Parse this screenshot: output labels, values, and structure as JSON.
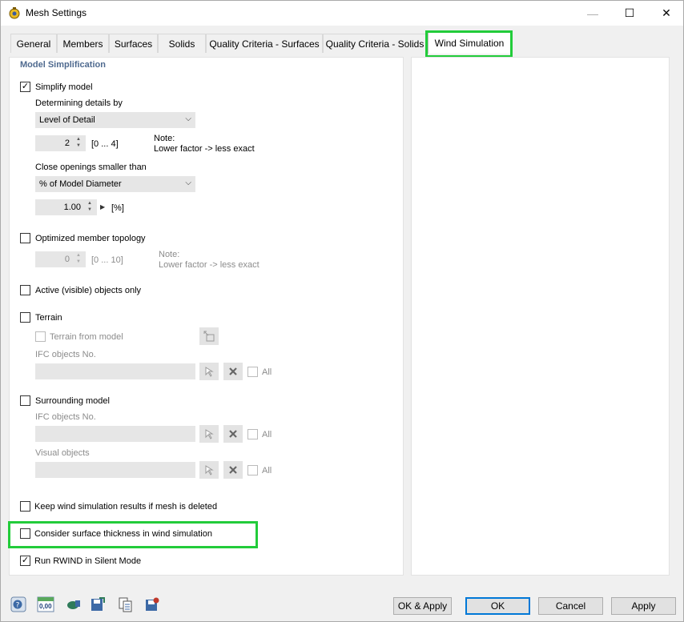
{
  "window": {
    "title": "Mesh Settings",
    "controls": {
      "minimize": "—",
      "maximize": "☐",
      "close": "✕"
    }
  },
  "tabs": [
    {
      "label": "General"
    },
    {
      "label": "Members"
    },
    {
      "label": "Surfaces"
    },
    {
      "label": "Solids"
    },
    {
      "label": "Quality Criteria - Surfaces"
    },
    {
      "label": "Quality Criteria - Solids"
    },
    {
      "label": "Wind Simulation",
      "active": true
    }
  ],
  "model_simplification": {
    "heading": "Model Simplification",
    "simplify_model": {
      "label": "Simplify model",
      "checked": true
    },
    "determining_label": "Determining details by",
    "determining_value": "Level of Detail",
    "level_value": "2",
    "level_range": "[0 ... 4]",
    "note_title": "Note:",
    "note_text": "Lower factor -> less exact",
    "close_openings_label": "Close openings smaller than",
    "close_openings_value": "% of Model Diameter",
    "diameter_value": "1.00",
    "diameter_unit": "[%]"
  },
  "optimized_topology": {
    "label": "Optimized member topology",
    "checked": false,
    "value": "0",
    "range": "[0 ... 10]",
    "note_title": "Note:",
    "note_text": "Lower factor -> less exact"
  },
  "active_objects": {
    "label": "Active (visible) objects only",
    "checked": false
  },
  "terrain": {
    "label": "Terrain",
    "checked": false,
    "from_model_label": "Terrain from model",
    "ifc_label": "IFC objects No.",
    "all_label": "All"
  },
  "surrounding": {
    "label": "Surrounding model",
    "checked": false,
    "ifc_label": "IFC objects No.",
    "visual_label": "Visual objects",
    "all_label": "All"
  },
  "keep_results": {
    "label": "Keep wind simulation results if mesh is deleted",
    "checked": false
  },
  "consider_thickness": {
    "label": "Consider surface thickness in wind simulation",
    "checked": false
  },
  "silent_mode": {
    "label": "Run RWIND in Silent Mode",
    "checked": true
  },
  "footer": {
    "units_icon_text": "0,00",
    "ok_apply": "OK & Apply",
    "ok": "OK",
    "cancel": "Cancel",
    "apply": "Apply"
  },
  "colors": {
    "highlight": "#22cc3a",
    "heading": "#4f6a8f",
    "primary_border": "#0078d7"
  }
}
